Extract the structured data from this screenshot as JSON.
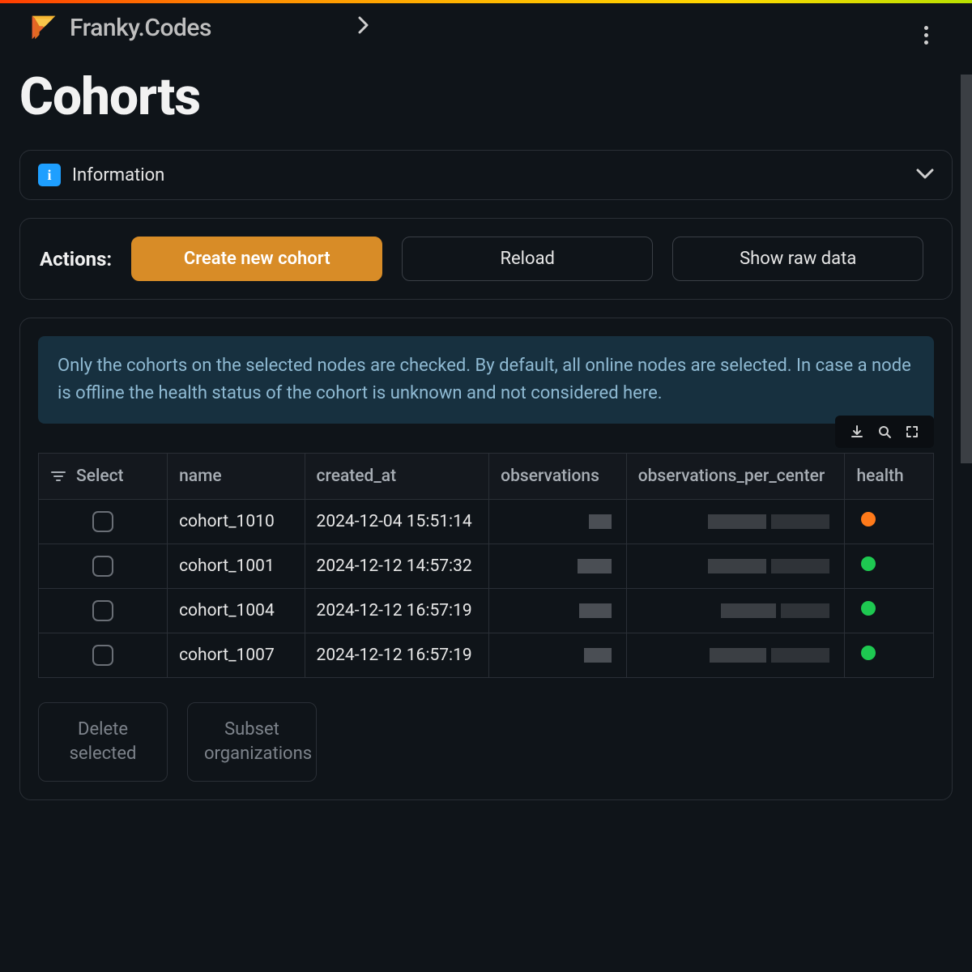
{
  "brand": "Franky.Codes",
  "page_title": "Cohorts",
  "info": {
    "label": "Information",
    "icon_glyph": "i"
  },
  "actions": {
    "label": "Actions:",
    "create": "Create new cohort",
    "reload": "Reload",
    "show_raw": "Show raw data"
  },
  "note": "Only the cohorts on the selected nodes are checked. By default, all online nodes are selected. In case a node is offline the health status of the cohort is unknown and not considered here.",
  "columns": {
    "select": "Select",
    "name": "name",
    "created_at": "created_at",
    "observations": "observations",
    "observations_per_center": "observations_per_center",
    "health": "health"
  },
  "rows": [
    {
      "name": "cohort_1010",
      "created_at": "2024-12-04 15:51:14",
      "health": "orange"
    },
    {
      "name": "cohort_1001",
      "created_at": "2024-12-12 14:57:32",
      "health": "green"
    },
    {
      "name": "cohort_1004",
      "created_at": "2024-12-12 16:57:19",
      "health": "green"
    },
    {
      "name": "cohort_1007",
      "created_at": "2024-12-12 16:57:19",
      "health": "green"
    }
  ],
  "footer": {
    "delete": "Delete selected",
    "subset": "Subset organizations"
  },
  "colors": {
    "orange": "#ff7a1a",
    "green": "#1ec951"
  }
}
